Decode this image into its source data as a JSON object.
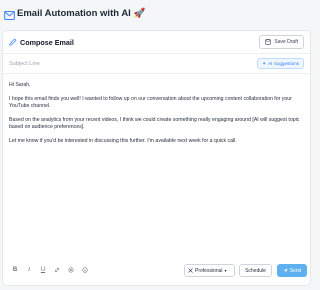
{
  "header": {
    "title": "Email Automation with AI 🚀",
    "icon": "mail-icon",
    "accent": "#3b82f6"
  },
  "compose": {
    "title": "Compose Email",
    "icon": "pencil-icon",
    "save_draft_label": "Save Draft",
    "save_draft_icon": "save-icon"
  },
  "subject": {
    "placeholder": "Subject Line",
    "value": "",
    "ai_suggestions_label": "AI Suggestions",
    "ai_icon": "sparkle-icon"
  },
  "body": {
    "paragraphs": [
      "Hi Sarah,",
      "I hope this email finds you well! I wanted to follow up on our conversation about the upcoming content collaboration for your YouTube channel.",
      "Based on the analytics from your recent videos, I think we could create something really engaging around [AI will suggest topic based on audience preferences].",
      "Let me know if you'd be interested in discussing this further. I'm available next week for a quick call."
    ]
  },
  "toolbar": {
    "format_buttons": [
      {
        "label": "B",
        "name": "bold-button"
      },
      {
        "label": "I",
        "name": "italic-button"
      },
      {
        "label": "U",
        "name": "underline-button"
      },
      {
        "label": "",
        "name": "link-button",
        "icon": "link-icon"
      },
      {
        "label": "",
        "name": "attach-button",
        "icon": "paperclip-icon"
      },
      {
        "label": "",
        "name": "emoji-button",
        "icon": "smile-icon"
      }
    ],
    "tone_value": "Professional",
    "schedule_label": "Schedule",
    "send_label": "Send",
    "send_color": "#5fb0ee"
  }
}
